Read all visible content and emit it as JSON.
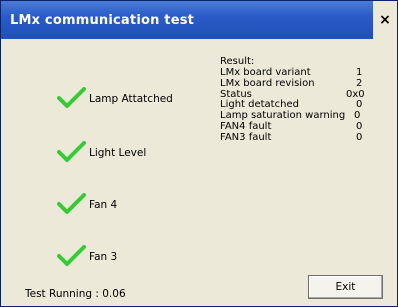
{
  "window": {
    "title": "LMx communication test",
    "close_label": "×"
  },
  "checks": [
    {
      "label": "Lamp Attatched",
      "icon": "checkmark-icon",
      "status": "pass"
    },
    {
      "label": "Light Level",
      "icon": "checkmark-icon",
      "status": "pass"
    },
    {
      "label": "Fan 4",
      "icon": "checkmark-icon",
      "status": "pass"
    },
    {
      "label": "Fan 3",
      "icon": "checkmark-icon",
      "status": "pass"
    }
  ],
  "results": {
    "heading": "Result:",
    "rows": [
      {
        "label": "LMx board variant",
        "value": "1"
      },
      {
        "label": "LMx board revision",
        "value": "2"
      },
      {
        "label": "Status",
        "value": "0x0"
      },
      {
        "label": "Light detatched",
        "value": "0"
      },
      {
        "label": "Lamp saturation warning",
        "value": "0"
      },
      {
        "label": "FAN4 fault",
        "value": "0"
      },
      {
        "label": "FAN3 fault",
        "value": "0"
      }
    ]
  },
  "status": {
    "text": "Test Running : 0.06"
  },
  "buttons": {
    "exit_label": "Exit"
  },
  "colors": {
    "title_bar": "#2a5bc8",
    "check_green": "#33cc33",
    "background": "#ece9d8"
  }
}
